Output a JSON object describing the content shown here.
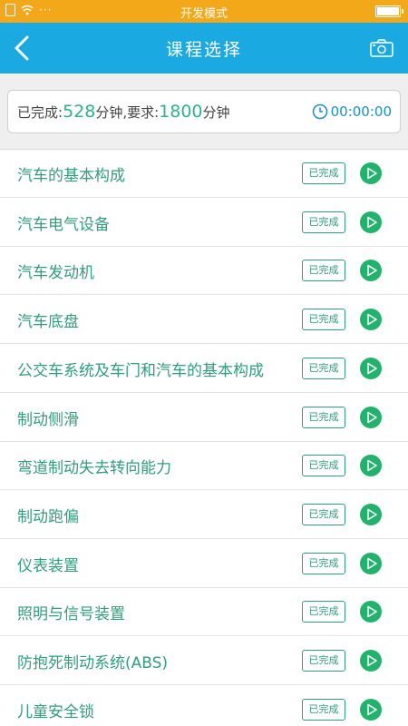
{
  "status_bar": {
    "signal": "···",
    "title": "开发模式"
  },
  "nav": {
    "title": "课程选择",
    "back_icon": "chevron-left-icon",
    "camera_icon": "camera-icon"
  },
  "progress": {
    "completed_label": "已完成:",
    "completed_value": "528",
    "unit1": "分钟,",
    "required_label": "要求:",
    "required_value": "1800",
    "unit2": "分钟",
    "timer": "00:00:00"
  },
  "courses": [
    {
      "name": "汽车的基本构成",
      "status": "已完成"
    },
    {
      "name": "汽车电气设备",
      "status": "已完成"
    },
    {
      "name": "汽车发动机",
      "status": "已完成"
    },
    {
      "name": "汽车底盘",
      "status": "已完成"
    },
    {
      "name": "公交车系统及车门和汽车的基本构成",
      "status": "已完成"
    },
    {
      "name": "制动侧滑",
      "status": "已完成"
    },
    {
      "name": "弯道制动失去转向能力",
      "status": "已完成"
    },
    {
      "name": "制动跑偏",
      "status": "已完成"
    },
    {
      "name": "仪表装置",
      "status": "已完成"
    },
    {
      "name": "照明与信号装置",
      "status": "已完成"
    },
    {
      "name": "防抱死制动系统(ABS)",
      "status": "已完成"
    },
    {
      "name": "儿童安全锁",
      "status": "已完成"
    }
  ],
  "colors": {
    "status_bar": "#f2a819",
    "nav_bar": "#1aa9e0",
    "accent_green": "#2f9e7e",
    "play_green": "#20b36b",
    "timer_blue": "#1a8fd0"
  }
}
